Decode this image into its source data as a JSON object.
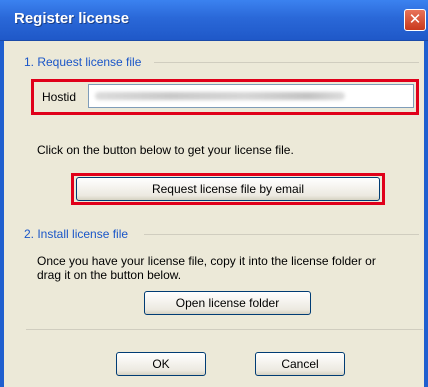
{
  "window": {
    "title": "Register license",
    "close_glyph": "✕"
  },
  "section1": {
    "label": "1. Request license file",
    "hostid_label": "Hostid",
    "hostid_value": "",
    "instruction": "Click on the button below to get your license file.",
    "request_button": "Request license file by email"
  },
  "section2": {
    "label": "2. Install license file",
    "instruction_line1": "Once you have your license file, copy it into the license folder or",
    "instruction_line2": "drag it on the button below.",
    "open_button": "Open license folder"
  },
  "footer": {
    "ok_label": "OK",
    "cancel_label": "Cancel"
  },
  "colors": {
    "title_bar": "#2a68d8",
    "highlight": "#e0001a",
    "group_label": "#1a56c8"
  }
}
